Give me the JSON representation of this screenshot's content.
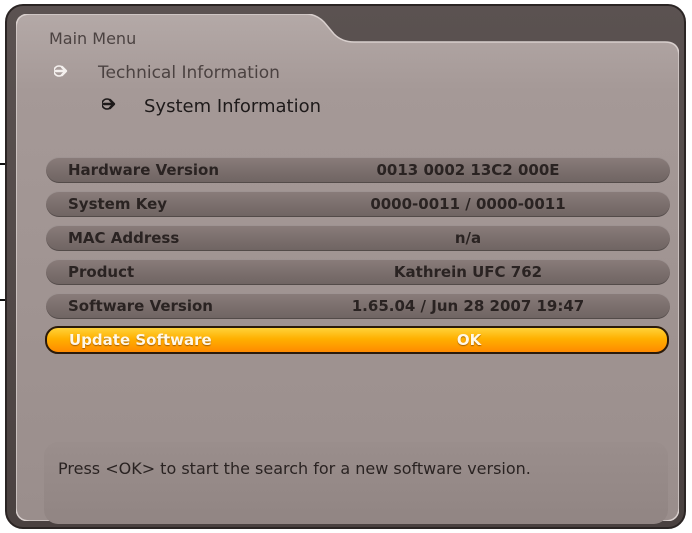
{
  "breadcrumb": {
    "main": "Main Menu",
    "level1": "Technical Information",
    "level2": "System Information"
  },
  "rows": [
    {
      "label": "Hardware Version",
      "value": "0013 0002 13C2 000E"
    },
    {
      "label": "System Key",
      "value": "0000-0011 / 0000-0011"
    },
    {
      "label": "MAC Address",
      "value": "n/a"
    },
    {
      "label": "Product",
      "value": "Kathrein  UFC 762"
    },
    {
      "label": "Software Version",
      "value": "1.65.04 / Jun 28 2007  19:47"
    },
    {
      "label": "Update Software",
      "value": "OK"
    }
  ],
  "selected_row": "Update Software",
  "help_text": "Press <OK> to start the search for a new software version.",
  "icons": {
    "breadcrumb_arrow": "arrow-right-icon"
  },
  "colors": {
    "panel": "#a09492",
    "row": "#7e7270",
    "selected": "#ffb000",
    "text": "#2a2322"
  }
}
